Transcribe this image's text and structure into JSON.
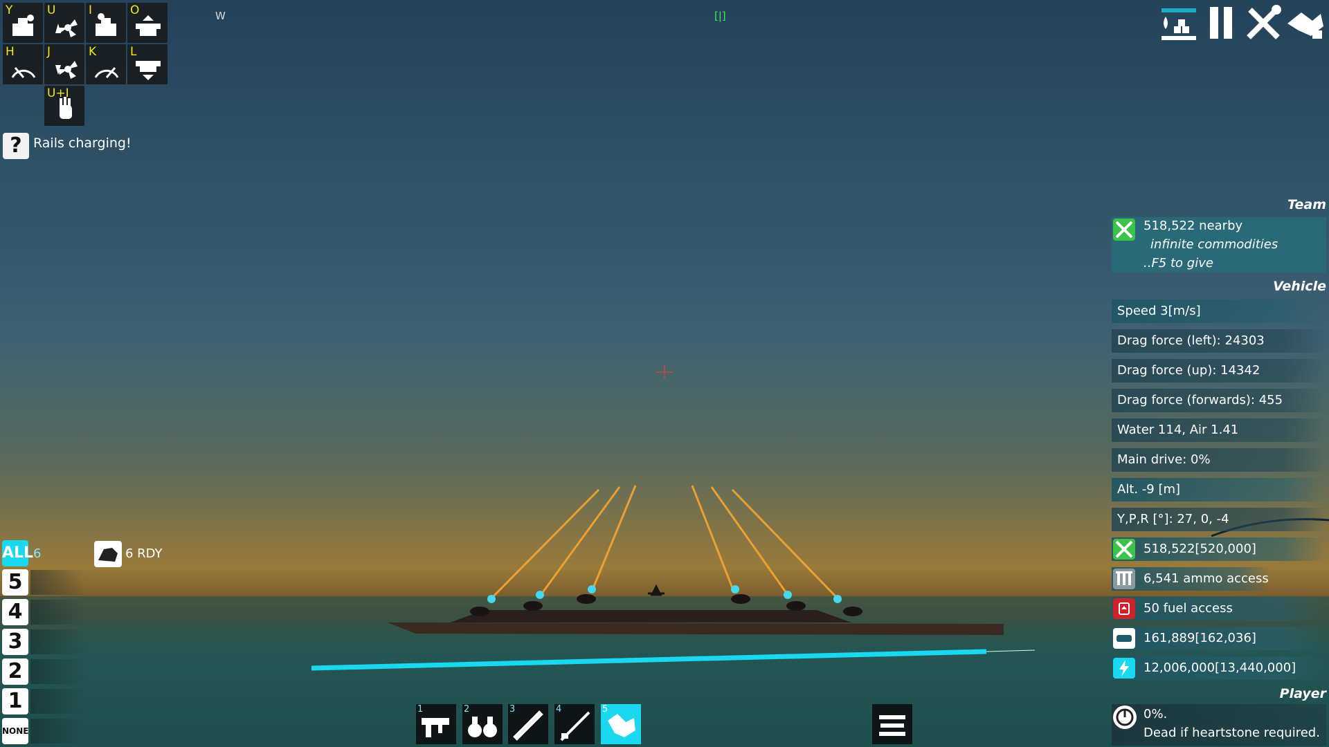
{
  "keybinds": [
    {
      "key": "Y",
      "icon": "ship-fire-icon"
    },
    {
      "key": "U",
      "icon": "propeller-up-icon"
    },
    {
      "key": "I",
      "icon": "ship-fire-icon"
    },
    {
      "key": "O",
      "icon": "turret-up-icon"
    },
    {
      "key": "H",
      "icon": "dial-left-icon"
    },
    {
      "key": "J",
      "icon": "propeller-down-icon"
    },
    {
      "key": "K",
      "icon": "dial-right-icon"
    },
    {
      "key": "L",
      "icon": "turret-down-icon"
    },
    {
      "key": "U+I",
      "icon": "hand-icon"
    }
  ],
  "hud": {
    "compass": "W",
    "marker": "[|]",
    "help_message": "Rails charging!"
  },
  "weapon_groups": {
    "all_label": "ALL",
    "all_count": "6",
    "ready_text": "6 RDY",
    "slots": [
      "5",
      "4",
      "3",
      "2",
      "1",
      "NONE"
    ]
  },
  "team": {
    "header": "Team",
    "nearby": "518,522 nearby",
    "commodities": "infinite commodities",
    "give": "..F5 to give"
  },
  "vehicle": {
    "header": "Vehicle",
    "speed": "Speed 3[m/s]",
    "drag_left": "Drag force (left): 24303",
    "drag_up": "Drag force (up): 14342",
    "drag_forwards": "Drag force (forwards): 455",
    "water_air": "Water 114, Air 1.41",
    "main_drive": "Main drive: 0%",
    "altitude": "Alt. -9 [m]",
    "ypr": "Y,P,R [°]: 27, 0, -4",
    "materials": "518,522[520,000]",
    "ammo": "6,541 ammo access",
    "fuel": "50 fuel access",
    "resource": "161,889[162,036]",
    "energy": "12,006,000[13,440,000]"
  },
  "player": {
    "header": "Player",
    "percent": "0%.",
    "status": "Dead if heartstone required."
  },
  "hotbar": [
    {
      "num": "1",
      "icon": "gun-icon"
    },
    {
      "num": "2",
      "icon": "binoculars-icon"
    },
    {
      "num": "3",
      "icon": "saw-icon"
    },
    {
      "num": "4",
      "icon": "rifle-icon"
    },
    {
      "num": "5",
      "icon": "build-tool-icon"
    }
  ],
  "colors": {
    "accent_cyan": "#19d8f0",
    "key_yellow": "#f0e81c",
    "panel_teal": "#286e7a",
    "fuel_red": "#d0202a",
    "green_icon": "#3cc24a"
  }
}
